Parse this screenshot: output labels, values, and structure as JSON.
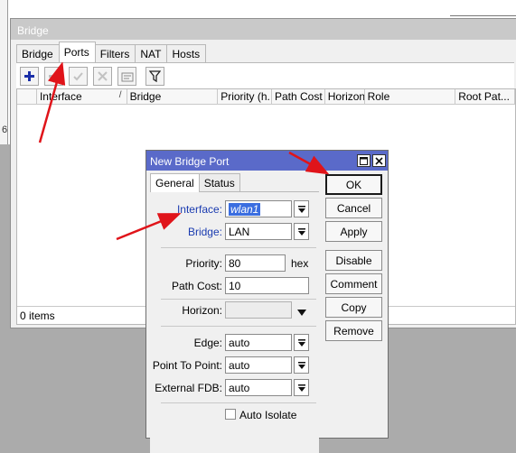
{
  "bridge_window": {
    "title": "Bridge",
    "tabs": [
      {
        "label": "Bridge"
      },
      {
        "label": "Ports"
      },
      {
        "label": "Filters"
      },
      {
        "label": "NAT"
      },
      {
        "label": "Hosts"
      }
    ],
    "active_tab": "Ports",
    "toolbar": [
      "add-icon",
      "remove-icon",
      "enable-icon",
      "disable-icon",
      "comment-icon",
      "filter-icon"
    ],
    "columns": [
      {
        "label": ""
      },
      {
        "label": "Interface"
      },
      {
        "label": "Bridge"
      },
      {
        "label": "Priority (h..."
      },
      {
        "label": "Path Cost"
      },
      {
        "label": "Horizon"
      },
      {
        "label": "Role"
      },
      {
        "label": "Root Pat..."
      }
    ],
    "status": "0 items",
    "edge_text": "6"
  },
  "dialog": {
    "title": "New Bridge Port",
    "tabs": [
      {
        "label": "General"
      },
      {
        "label": "Status"
      }
    ],
    "active_tab": "General",
    "fields": {
      "interface": {
        "label": "Interface:",
        "value": "wlan1"
      },
      "bridge": {
        "label": "Bridge:",
        "value": "LAN"
      },
      "priority": {
        "label": "Priority:",
        "value": "80",
        "unit": "hex"
      },
      "path_cost": {
        "label": "Path Cost:",
        "value": "10"
      },
      "horizon": {
        "label": "Horizon:",
        "value": ""
      },
      "edge": {
        "label": "Edge:",
        "value": "auto"
      },
      "point_to_point": {
        "label": "Point To Point:",
        "value": "auto"
      },
      "external_fdb": {
        "label": "External FDB:",
        "value": "auto"
      },
      "auto_isolate": {
        "label": "Auto Isolate",
        "checked": false
      }
    },
    "buttons": {
      "ok": "OK",
      "cancel": "Cancel",
      "apply": "Apply",
      "disable": "Disable",
      "comment": "Comment",
      "copy": "Copy",
      "remove": "Remove"
    }
  },
  "colors": {
    "dialog_titlebar": "#5a6ac9",
    "field_label_blue": "#1a3bb0",
    "selection": "#3b6ee0",
    "annotation_arrow": "#e0141a"
  }
}
